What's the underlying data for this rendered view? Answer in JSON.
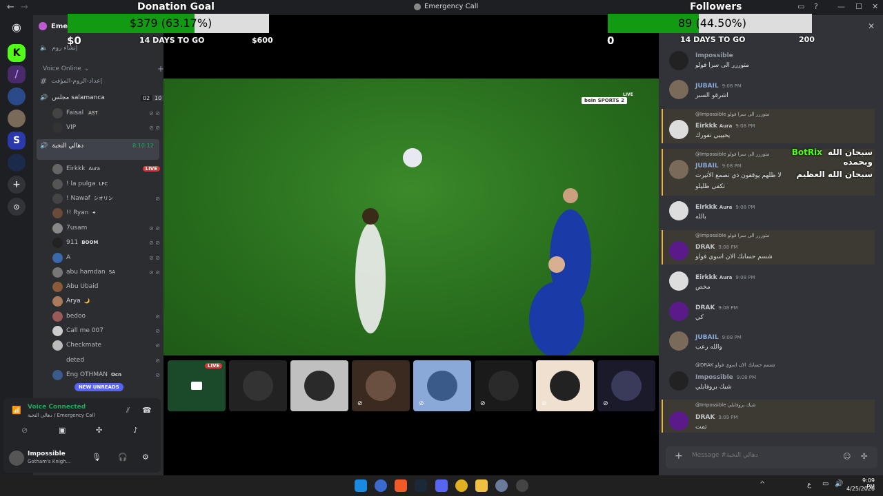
{
  "titlebar": {
    "title": "Emergency Call",
    "back": "←",
    "forward": "→"
  },
  "overlay": {
    "donation_title": "Donation Goal",
    "donation_amount": "$379 (63.17%)",
    "donation_fill": 0.6317,
    "donation_start": "$0",
    "donation_days": "14 DAYS TO GO",
    "donation_goal": "$600",
    "followers_title": "Followers",
    "followers_amount": "89 (44.50%)",
    "followers_fill": 0.445,
    "followers_start": "0",
    "followers_days": "14 DAYS TO GO",
    "followers_goal": "200"
  },
  "server": {
    "name": "Eme",
    "create_room": "إنشاء روم",
    "voice_online": "Voice Online",
    "temp_room": "إعداد-الروم-المؤقت"
  },
  "channels": {
    "salamanca": {
      "name": "مجلس salamanca",
      "count1": "02",
      "count2": "10"
    },
    "active": {
      "name": "دهالي النخبة",
      "timer": "8:10:12"
    }
  },
  "salamanca_members": [
    {
      "name": "Faisal",
      "tag": "AST"
    },
    {
      "name": "VIP",
      "tag": ""
    }
  ],
  "members": [
    {
      "name": "Eirkkk",
      "tag": "Aura",
      "live": "LIVE"
    },
    {
      "name": "! la pulga",
      "tag": "LFC"
    },
    {
      "name": "! Nawaf",
      "tag": "シオリン"
    },
    {
      "name": "!! Ryan",
      "tag": "✦"
    },
    {
      "name": "7usam",
      "tag": ""
    },
    {
      "name": "911",
      "tag": "BOOM"
    },
    {
      "name": "A",
      "tag": ""
    },
    {
      "name": "abu hamdan",
      "tag": "SA"
    },
    {
      "name": "Abu Ubaid",
      "tag": ""
    },
    {
      "name": "Arya",
      "tag": "🌙"
    },
    {
      "name": "bedoo",
      "tag": ""
    },
    {
      "name": "Call me 007",
      "tag": ""
    },
    {
      "name": "Checkmate",
      "tag": ""
    },
    {
      "name": "deted",
      "tag": ""
    },
    {
      "name": "Eng OTHMAN",
      "tag": "Ocn"
    }
  ],
  "new_unreads": "NEW UNREADS",
  "voice": {
    "status": "Voice Connected",
    "channel": "دهالي النخبة / Emergency Call"
  },
  "user": {
    "name": "Impossible",
    "status": "Gotham's Knigh..."
  },
  "video": {
    "channel_badge": "bein SPORTS 2",
    "live": "LIVE"
  },
  "tiles": [
    {
      "live": "LIVE"
    }
  ],
  "chat": {
    "placeholder": "Message #دهالي النخبة",
    "overlay_text1": "سبحان الله وبحمده",
    "overlay_bot": "BotRix",
    "overlay_text2": "سبحان الله العظيم",
    "top_partial": {
      "name": "Impossible",
      "time": "9:08 PM",
      "text": "متوررر الى سرا فولو"
    },
    "messages": [
      {
        "name": "JUBAIL",
        "time": "9:08 PM",
        "text": "اشرقو السبر"
      },
      {
        "reply": "@Impossible متوررر الى سرا فولو",
        "name": "Eirkkk",
        "tag": "Aura",
        "time": "9:08 PM",
        "text": "يحيييي تفورك"
      },
      {
        "reply": "@Impossible  متوررر الى سرا فولو",
        "name": "JUBAIL",
        "time": "9:08 PM",
        "text": "لا ظلهم يوقفون ذي تصمع الأثيرت",
        "text2": "تكفى ظليلو"
      },
      {
        "name": "Eirkkk",
        "tag": "Aura",
        "time": "9:08 PM",
        "text": "بالله"
      },
      {
        "reply": "@Impossible متوررر الى سرا فولو",
        "name": "DRAK",
        "time": "9:08 PM",
        "text": "شسم حسابك الان اسوي فولو"
      },
      {
        "name": "Eirkkk",
        "tag": "Aura",
        "time": "9:08 PM",
        "text": "مخص"
      },
      {
        "name": "DRAK",
        "time": "9:08 PM",
        "text": "كي"
      },
      {
        "name": "JUBAIL",
        "time": "9:08 PM",
        "text": "والله رعب"
      },
      {
        "reply": "@DRAK شسم حسابك الان اسوي فولو",
        "name": "Impossible",
        "time": "9:08 PM",
        "text": "شيك بروفايلي"
      },
      {
        "reply": "@Impossible شيك بروفايلي",
        "name": "DRAK",
        "time": "9:09 PM",
        "text": "تمت"
      }
    ]
  },
  "taskbar": {
    "time": "9:09 PM",
    "date": "4/25/2026",
    "lang": "ع"
  }
}
